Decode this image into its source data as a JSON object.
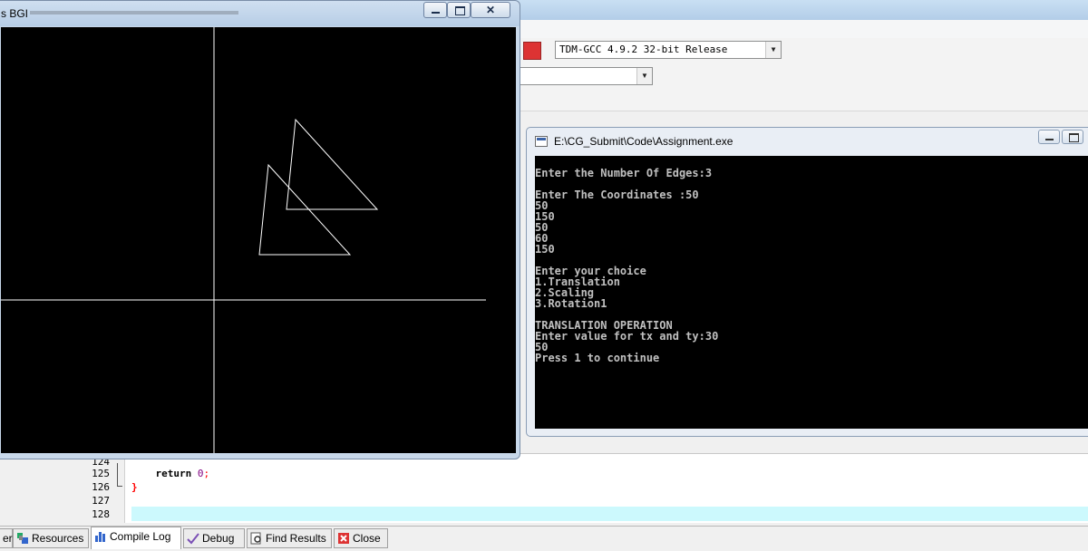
{
  "ide": {
    "compiler_select": "TDM-GCC 4.9.2 32-bit Release",
    "class_select": ""
  },
  "editor": {
    "lines": [
      {
        "num": "124",
        "code": ""
      },
      {
        "num": "125",
        "code": "    return 0;"
      },
      {
        "num": "126",
        "code": "}"
      },
      {
        "num": "127",
        "code": ""
      },
      {
        "num": "128",
        "code": ""
      }
    ]
  },
  "tabs": [
    {
      "label": "er",
      "icon": "compiler-icon",
      "active": false
    },
    {
      "label": "Resources",
      "icon": "resources-icon",
      "active": false
    },
    {
      "label": "Compile Log",
      "icon": "chart-icon",
      "active": true
    },
    {
      "label": "Debug",
      "icon": "check-icon",
      "active": false
    },
    {
      "label": "Find Results",
      "icon": "find-icon",
      "active": false
    },
    {
      "label": "Close",
      "icon": "close-icon",
      "active": false
    }
  ],
  "console": {
    "title": "E:\\CG_Submit\\Code\\Assignment.exe",
    "lines": [
      "Enter the Number Of Edges:3",
      "",
      "Enter The Coordinates :50",
      "50",
      "150",
      "50",
      "60",
      "150",
      "",
      "Enter your choice",
      "1.Translation",
      "2.Scaling",
      "3.Rotation1",
      "",
      "TRANSLATION OPERATION",
      "Enter value for tx and ty:30",
      "50",
      "Press 1 to continue"
    ]
  },
  "bgi": {
    "title": "s BGI",
    "min_label": "–",
    "max_label": "□",
    "close_label": "✕"
  },
  "colors": {
    "console_text": "#c0c0c0",
    "highlight": "#ccf9fd",
    "graphics_line": "#ffffff"
  }
}
